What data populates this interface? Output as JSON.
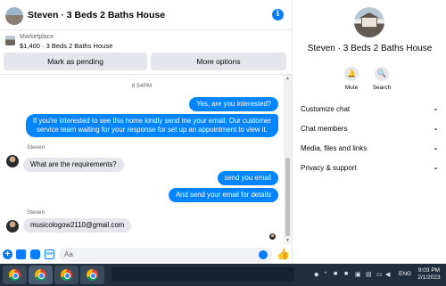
{
  "header": {
    "title": "Steven · 3 Beds 2 Baths House",
    "info_icon": "info-icon"
  },
  "listing": {
    "source": "Marketplace",
    "price_title": "$1,400 · 3 Beds 2 Baths House"
  },
  "actions": {
    "pending_label": "Mark as pending",
    "more_label": "More options"
  },
  "messages": {
    "timestamp": "8:54PM",
    "sender_name": "Steven",
    "items": [
      {
        "direction": "out",
        "text": "Yes, are you interested?"
      },
      {
        "direction": "out",
        "text": "If you're interested to see this home kindly  send me your email. Our customer\nservice team waiting for your response for set up an appointment to view it."
      },
      {
        "direction": "in",
        "text": "What are the requirements?"
      },
      {
        "direction": "out",
        "text": "send you email"
      },
      {
        "direction": "out",
        "text": "And send your email for details"
      },
      {
        "direction": "in",
        "text": "musicologow2110@gmail.com"
      }
    ]
  },
  "composer": {
    "placeholder": "Aa",
    "like_icon": "thumbs-up-icon"
  },
  "info_panel": {
    "name": "Steven · 3 Beds 2 Baths House",
    "mute_label": "Mute",
    "search_label": "Search",
    "sections": [
      "Customize chat",
      "Chat members",
      "Media, files and links",
      "Privacy & support"
    ]
  },
  "taskbar": {
    "language": "ENG",
    "time": "9:03 PM",
    "date": "2/1/2023"
  },
  "colors": {
    "accent": "#0084ff",
    "bubble_in": "#e4e6eb",
    "taskbar": "#1f2d3d"
  }
}
